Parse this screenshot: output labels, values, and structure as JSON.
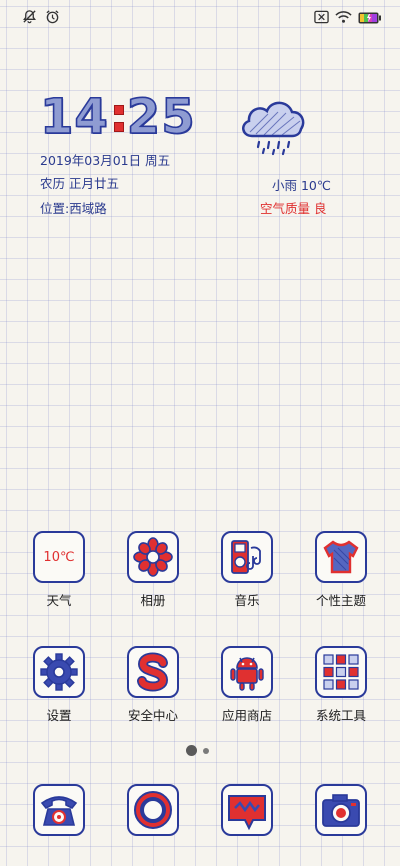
{
  "status_bar": {
    "left_icons": [
      "notifications-off-icon",
      "alarm-icon"
    ],
    "right_icons": [
      "sim-x-icon",
      "wifi-icon",
      "battery-icon"
    ]
  },
  "clock": {
    "hours": "14",
    "minutes": "25"
  },
  "date": {
    "gregorian": "2019年03月01日 周五",
    "lunar": "农历 正月廿五",
    "location": "位置:西域路"
  },
  "weather": {
    "condition": "小雨 10℃",
    "air_quality": "空气质量 良"
  },
  "apps": [
    {
      "label": "天气",
      "icon": "weather-temp-icon",
      "tile_text": "10℃"
    },
    {
      "label": "相册",
      "icon": "gallery-flower-icon"
    },
    {
      "label": "音乐",
      "icon": "music-player-icon"
    },
    {
      "label": "个性主题",
      "icon": "theme-shirt-icon"
    },
    {
      "label": "设置",
      "icon": "settings-gear-icon"
    },
    {
      "label": "安全中心",
      "icon": "security-s-icon"
    },
    {
      "label": "应用商店",
      "icon": "android-store-icon"
    },
    {
      "label": "系统工具",
      "icon": "tools-grid-icon"
    }
  ],
  "dock": [
    {
      "icon": "phone-icon"
    },
    {
      "icon": "browser-icon"
    },
    {
      "icon": "messages-icon"
    },
    {
      "icon": "camera-icon"
    }
  ],
  "pager": {
    "pages": 2,
    "current": 1
  },
  "colors": {
    "ink_blue": "#2a3a9a",
    "accent_red": "#e03030",
    "paper": "#f6f4ee"
  }
}
